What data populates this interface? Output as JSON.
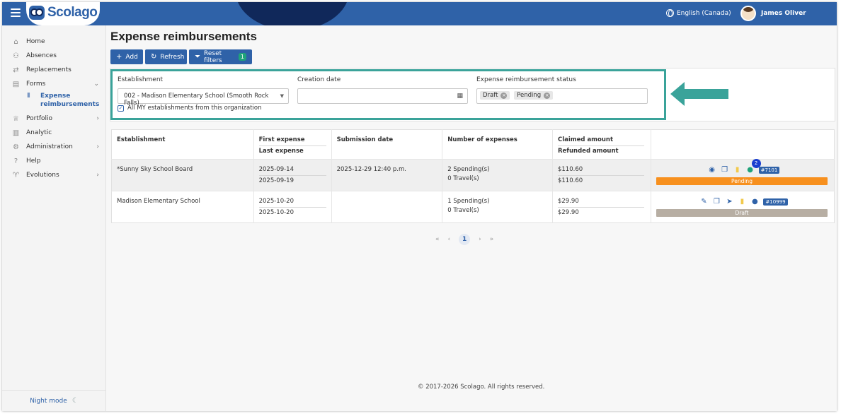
{
  "app": {
    "logo_text": "Scolago"
  },
  "header": {
    "language": "English (Canada)",
    "user_name": "James Oliver"
  },
  "sidebar": {
    "items": [
      {
        "label": "Home",
        "icon": "home-icon"
      },
      {
        "label": "Absences",
        "icon": "absence-icon"
      },
      {
        "label": "Replacements",
        "icon": "replacement-icon"
      },
      {
        "label": "Forms",
        "icon": "forms-icon",
        "expandable": true
      },
      {
        "label": "Portfolio",
        "icon": "trophy-icon",
        "expandable": true
      },
      {
        "label": "Analytic",
        "icon": "analytic-icon"
      },
      {
        "label": "Administration",
        "icon": "gear-icon",
        "expandable": true
      },
      {
        "label": "Help",
        "icon": "help-icon"
      },
      {
        "label": "Evolutions",
        "icon": "sprout-icon",
        "expandable": true
      }
    ],
    "sub_item": {
      "label": "Expense reimbursements",
      "icon": "document-icon"
    },
    "night_mode": "Night mode"
  },
  "page": {
    "title": "Expense reimbursements"
  },
  "toolbar": {
    "add": "Add",
    "refresh": "Refresh",
    "reset_filters": "Reset filters",
    "reset_count": "1"
  },
  "filters": {
    "establishment_label": "Establishment",
    "establishment_value": "002 - Madison Elementary School (Smooth Rock Falls)",
    "all_establishments": "All MY establishments from this organization",
    "creation_date_label": "Creation date",
    "creation_date_value": "",
    "status_label": "Expense reimbursement status",
    "status_chips": [
      "Draft",
      "Pending"
    ]
  },
  "annotation": {
    "arrow_color": "#3aa39a"
  },
  "table": {
    "headers": {
      "establishment": "Establishment",
      "first_expense": "First expense",
      "last_expense": "Last expense",
      "submission_date": "Submission date",
      "number_of_expenses": "Number of expenses",
      "claimed_amount": "Claimed amount",
      "refunded_amount": "Refunded amount"
    },
    "rows": [
      {
        "establishment": "*Sunny Sky School Board",
        "first_expense": "2025-09-14",
        "last_expense": "2025-09-19",
        "submission_date": "2025-12-29 12:40 p.m.",
        "spending": "2 Spending(s)",
        "travel": "0 Travel(s)",
        "claimed": "$110.60",
        "refunded": "$110.60",
        "comment_count": "2",
        "id_tag": "#7101",
        "status": "Pending",
        "status_color": "#f7901e"
      },
      {
        "establishment": "Madison Elementary School",
        "first_expense": "2025-10-20",
        "last_expense": "2025-10-20",
        "submission_date": "",
        "spending": "1 Spending(s)",
        "travel": "0 Travel(s)",
        "claimed": "$29.90",
        "refunded": "$29.90",
        "id_tag": "#10999",
        "status": "Draft",
        "status_color": "#b7aea3"
      }
    ]
  },
  "pagination": {
    "current": "1"
  },
  "footer": {
    "copyright": "© 2017-2026 Scolago. All rights reserved."
  },
  "colors": {
    "primary": "#2f62a8",
    "accent": "#3aa39a",
    "pending": "#f7901e",
    "draft": "#b7aea3"
  }
}
